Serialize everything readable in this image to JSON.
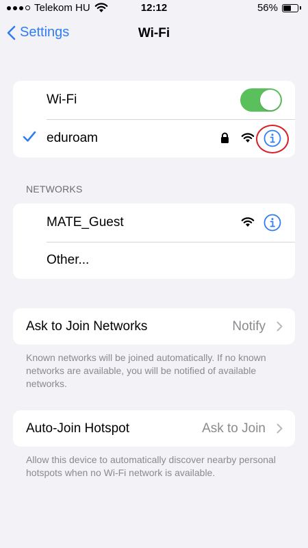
{
  "status_bar": {
    "carrier": "Telekom HU",
    "time": "12:12",
    "battery_percent": "56%",
    "battery_level": 0.56,
    "signal_bars_filled": 3,
    "signal_bars_total": 4
  },
  "nav": {
    "back_label": "Settings",
    "title": "Wi-Fi"
  },
  "wifi_card": {
    "toggle_label": "Wi-Fi",
    "toggle_on": true,
    "connected_network": "eduroam"
  },
  "networks": {
    "header": "NETWORKS",
    "items": [
      {
        "name": "MATE_Guest"
      },
      {
        "name": "Other..."
      }
    ]
  },
  "ask_to_join": {
    "label": "Ask to Join Networks",
    "value": "Notify",
    "footnote": "Known networks will be joined automatically. If no known networks are available, you will be notified of available networks."
  },
  "auto_join": {
    "label": "Auto-Join Hotspot",
    "value": "Ask to Join",
    "footnote": "Allow this device to automatically discover nearby personal hotspots when no Wi-Fi network is available."
  },
  "colors": {
    "accent": "#2f7cf6",
    "toggle_on": "#5ac05b",
    "highlight": "#d9202a",
    "background": "#f2f2f7"
  }
}
